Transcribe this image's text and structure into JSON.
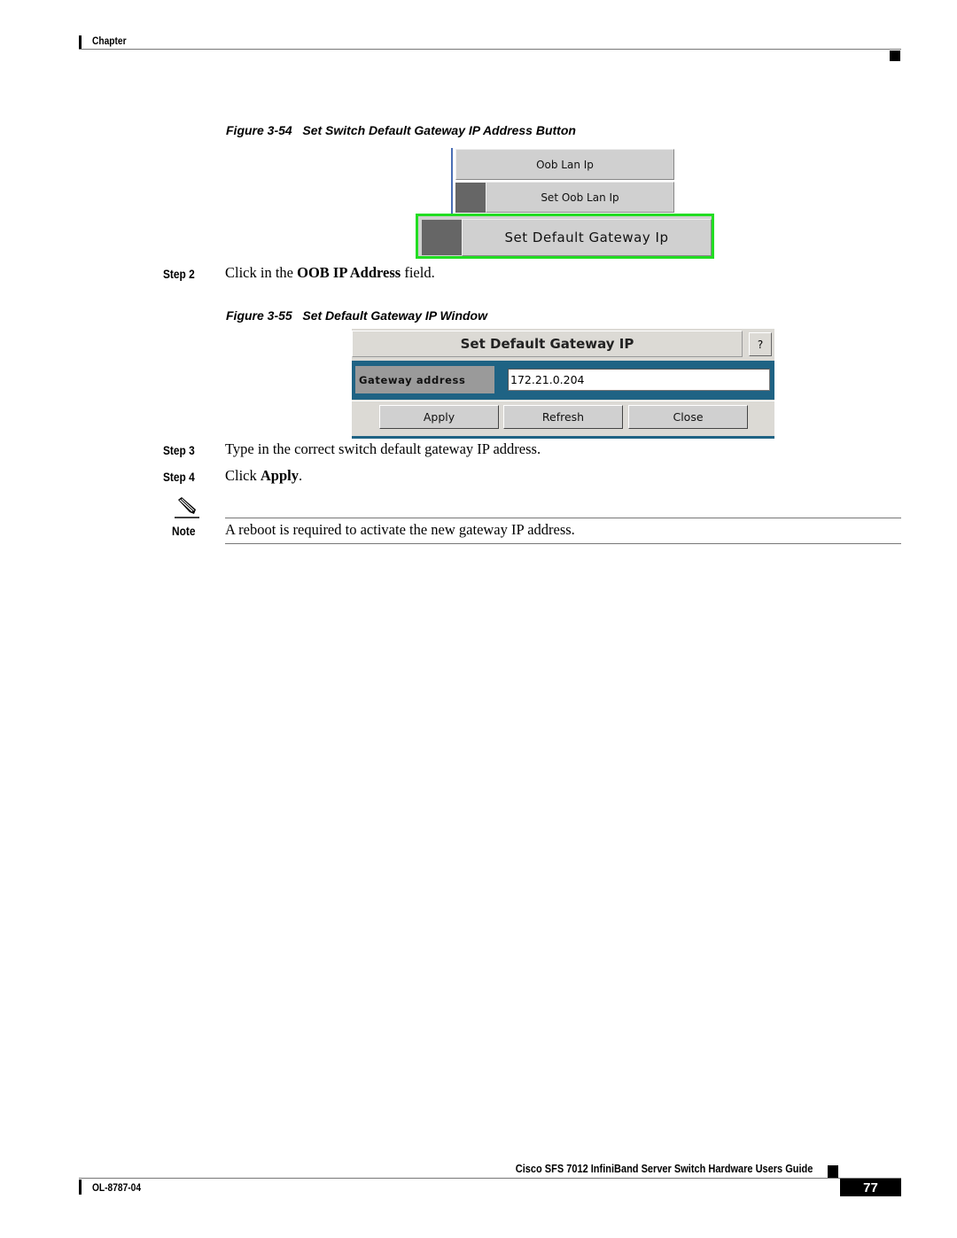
{
  "header": {
    "chapter_label": "Chapter"
  },
  "figure54": {
    "caption_num": "Figure 3-54",
    "caption_title": "Set Switch Default Gateway IP Address Button",
    "buttons": [
      "Oob Lan Ip",
      "Set Oob Lan Ip",
      "Set Default Gateway Ip"
    ],
    "highlight_color": "#22dd22"
  },
  "steps": [
    {
      "label": "Step 2",
      "text_pre": "Click in the ",
      "text_bold": "OOB IP Address",
      "text_post": " field."
    },
    {
      "label": "Step 3",
      "text": "Type in the correct switch default gateway IP address."
    },
    {
      "label": "Step 4",
      "text_pre": "Click ",
      "text_bold": "Apply",
      "text_post": "."
    }
  ],
  "figure55": {
    "caption_num": "Figure 3-55",
    "caption_title": "Set Default Gateway IP Window",
    "window_title": "Set Default Gateway IP",
    "help_label": "?",
    "field_label": "Gateway address",
    "field_value": "172.21.0.204",
    "buttons": {
      "apply": "Apply",
      "refresh": "Refresh",
      "close": "Close"
    },
    "band_color": "#1f6384"
  },
  "note": {
    "label": "Note",
    "icon": "pencil-icon",
    "text": "A reboot is required to activate the new gateway IP address."
  },
  "footer": {
    "guide_title": "Cisco SFS 7012 InfiniBand Server Switch Hardware Users Guide",
    "doc_number": "OL-8787-04",
    "page_number": "77"
  }
}
